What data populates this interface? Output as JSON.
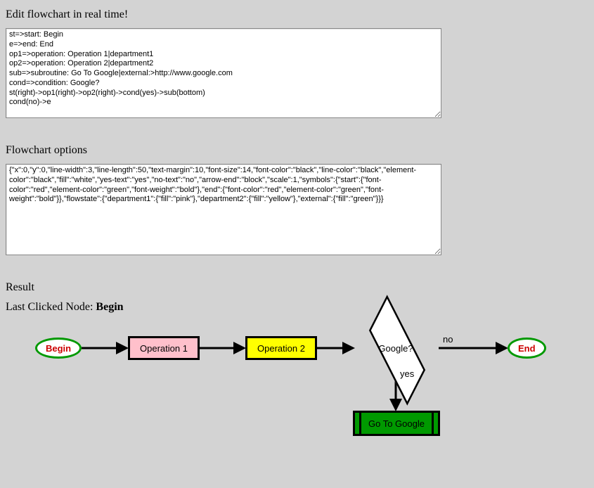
{
  "headings": {
    "edit": "Edit flowchart in real time!",
    "options": "Flowchart options",
    "result": "Result"
  },
  "last_clicked": {
    "prefix": "Last Clicked Node: ",
    "value": "Begin"
  },
  "flowchart_source": "st=>start: Begin\ne=>end: End\nop1=>operation: Operation 1|department1\nop2=>operation: Operation 2|department2\nsub=>subroutine: Go To Google|external:>http://www.google.com\ncond=>condition: Google?\nst(right)->op1(right)->op2(right)->cond(yes)->sub(bottom)\ncond(no)->e",
  "options_source": "{\"x\":0,\"y\":0,\"line-width\":3,\"line-length\":50,\"text-margin\":10,\"font-size\":14,\"font-color\":\"black\",\"line-color\":\"black\",\"element-color\":\"black\",\"fill\":\"white\",\"yes-text\":\"yes\",\"no-text\":\"no\",\"arrow-end\":\"block\",\"scale\":1,\"symbols\":{\"start\":{\"font-color\":\"red\",\"element-color\":\"green\",\"font-weight\":\"bold\"},\"end\":{\"font-color\":\"red\",\"element-color\":\"green\",\"font-weight\":\"bold\"}},\"flowstate\":{\"department1\":{\"fill\":\"pink\"},\"department2\":{\"fill\":\"yellow\"},\"external\":{\"fill\":\"green\"}}}",
  "nodes": {
    "begin": "Begin",
    "op1": "Operation 1",
    "op2": "Operation 2",
    "cond": "Google?",
    "end": "End",
    "sub": "Go To Google"
  },
  "edge_labels": {
    "yes": "yes",
    "no": "no"
  }
}
